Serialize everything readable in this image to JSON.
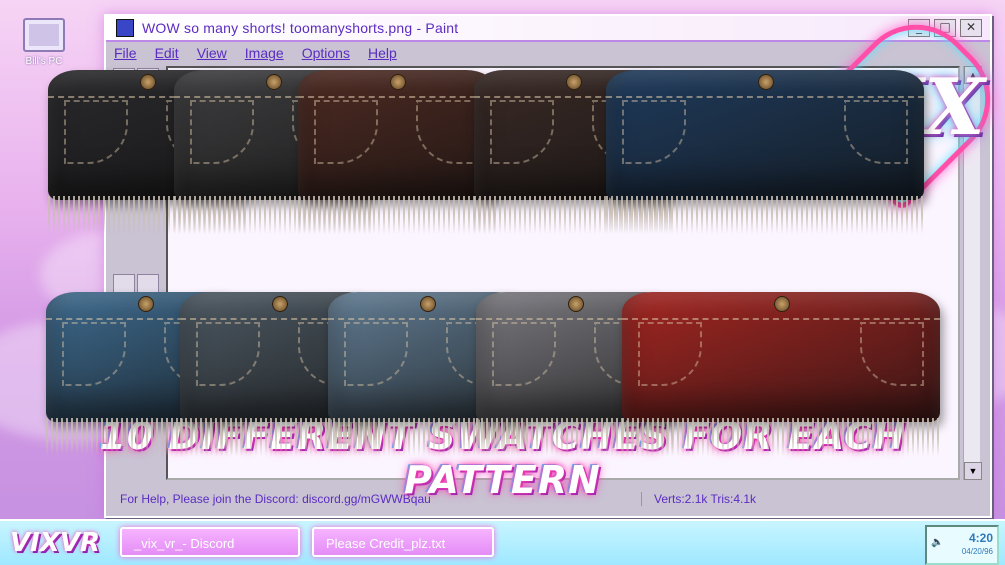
{
  "desktop": {
    "icon_label": "Bill's PC"
  },
  "window": {
    "title": "WOW so many shorts! toomanyshorts.png - Paint",
    "controls": [
      "_",
      "□",
      "✕"
    ],
    "menu": [
      "File",
      "Edit",
      "View",
      "Image",
      "Options",
      "Help"
    ],
    "status_help": "For Help, Please join the Discord: discord.gg/mGWWBqau",
    "status_stats": "Verts:2.1k  Tris:4.1k"
  },
  "shorts": {
    "row1": [
      {
        "name": "black",
        "color": "#2a2a2d"
      },
      {
        "name": "charcoal",
        "color": "#3e3e40"
      },
      {
        "name": "brown",
        "color": "#4e2a22"
      },
      {
        "name": "dark-brown",
        "color": "#3a2a26"
      },
      {
        "name": "navy",
        "color": "#1f3b5c"
      }
    ],
    "row2": [
      {
        "name": "blue",
        "color": "#3e6b8f"
      },
      {
        "name": "slate",
        "color": "#4d5963"
      },
      {
        "name": "steel",
        "color": "#627d94"
      },
      {
        "name": "gray",
        "color": "#7a7a80"
      },
      {
        "name": "red",
        "color": "#a32622"
      }
    ]
  },
  "logo": {
    "text": "VIX"
  },
  "headline": "10 DIFFERENT SWATCHES FOR EACH PATTERN",
  "taskbar": {
    "start_label": "VIXVR",
    "tasks": [
      "_vix_vr_- Discord",
      "Please Credit_plz.txt"
    ],
    "clock_time": "4:20",
    "clock_date": "04/20/96"
  }
}
